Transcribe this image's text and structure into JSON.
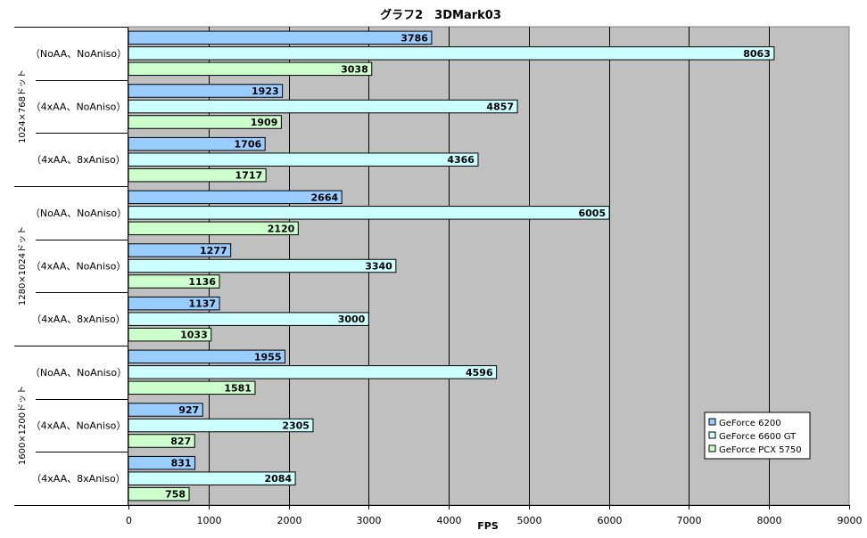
{
  "chart_data": {
    "type": "bar",
    "orientation": "horizontal",
    "title": "グラフ2　3DMark03",
    "xlabel": "FPS",
    "ylabel": "",
    "xlim": [
      0,
      9000
    ],
    "x_ticks": [
      0,
      1000,
      2000,
      3000,
      4000,
      5000,
      6000,
      7000,
      8000,
      9000
    ],
    "grid": true,
    "legend_position": "bottom-right",
    "groups": [
      {
        "label": "1024×768ドット",
        "categories": [
          "（NoAA、NoAniso）",
          "（4xAA、NoAniso）",
          "（4xAA、8xAniso）"
        ]
      },
      {
        "label": "1280×1024ドット",
        "categories": [
          "（NoAA、NoAniso）",
          "（4xAA、NoAniso）",
          "（4xAA、8xAniso）"
        ]
      },
      {
        "label": "1600×1200ドット",
        "categories": [
          "（NoAA、NoAniso）",
          "（4xAA、NoAniso）",
          "（4xAA、8xAniso）"
        ]
      }
    ],
    "series": [
      {
        "name": "GeForce 6200",
        "color": "#99ccff",
        "values": [
          3786,
          1923,
          1706,
          2664,
          1277,
          1137,
          1955,
          927,
          831
        ]
      },
      {
        "name": "GeForce 6600 GT",
        "color": "#ccffff",
        "values": [
          8063,
          4857,
          4366,
          6005,
          3340,
          3000,
          4596,
          2305,
          2084
        ]
      },
      {
        "name": "GeForce PCX 5750",
        "color": "#ccffcc",
        "values": [
          3038,
          1909,
          1717,
          2120,
          1136,
          1033,
          1581,
          827,
          758
        ]
      }
    ],
    "plot_background": "#c0c0c0"
  }
}
